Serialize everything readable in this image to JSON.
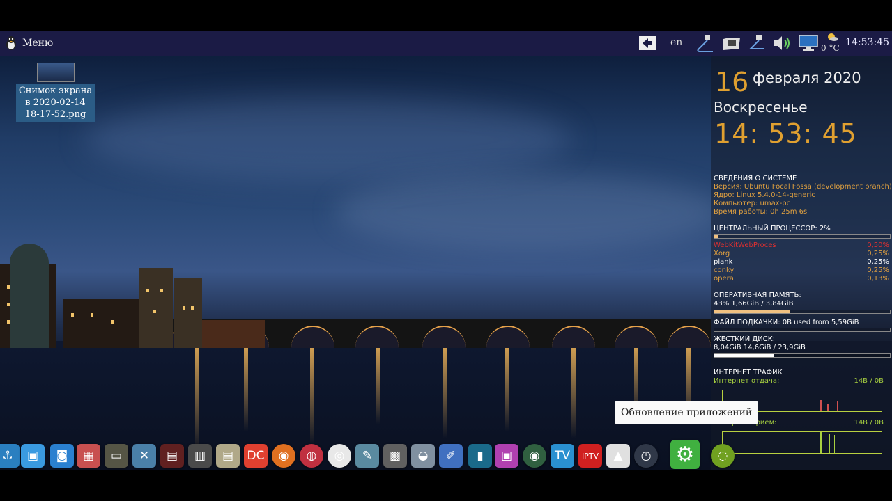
{
  "topbar": {
    "menu_label": "Меню",
    "lang": "en",
    "temperature": "0 °C",
    "clock": "14:53:45",
    "icons": [
      "back-arrow-icon",
      "pen-tablet-icon",
      "folder-mount-icon",
      "network-tool-icon",
      "volume-icon",
      "monitor-icon",
      "weather-icon"
    ]
  },
  "desktop": {
    "file_label": "Снимок экрана в 2020-02-14 18-17-52.png"
  },
  "conky": {
    "day": "16",
    "month_year": "февраля 2020",
    "weekday": "Воскресенье",
    "time": "14: 53: 45",
    "sys_head": "СВЕДЕНИЯ О СИСТЕМЕ",
    "version": "Версия: Ubuntu Focal Fossa (development branch)",
    "kernel": "Ядро: Linux 5.4.0-14-generic",
    "computer": "Компьютер: umax-pc",
    "uptime": "Время работы: 0h 25m 6s",
    "cpu_head": "ЦЕНТРАЛЬНЫЙ ПРОЦЕССОР: 2%",
    "cpu_percent": 2,
    "processes": [
      {
        "name": "WebKitWebProces",
        "value": "0,50%",
        "color": "#e03030"
      },
      {
        "name": "Xorg",
        "value": "0,25%",
        "color": "#e0a040"
      },
      {
        "name": "plank",
        "value": "0,25%",
        "color": "#ffffff"
      },
      {
        "name": "conky",
        "value": "0,25%",
        "color": "#e0a040"
      },
      {
        "name": "opera",
        "value": "0,13%",
        "color": "#e0a040"
      }
    ],
    "ram_head": "ОПЕРАТИВНАЯ ПАМЯТЬ:",
    "ram_value": "43% 1,66GiB / 3,84GiB",
    "ram_percent": 43,
    "swap_head": "ФАЙЛ ПОДКАЧКИ: 0B   used from 5,59GiB",
    "swap_percent": 0,
    "disk_head": "ЖЕСТКИЙ ДИСК:",
    "disk_value": "8,04GiB 14,6GiB / 23,9GiB",
    "disk_percent": 34,
    "net_head": "ИНТЕРНЕТ ТРАФИК",
    "up_label": "Интернет отдача:",
    "up_value": "14B    /  0B",
    "down_label": "Интернет прием:",
    "down_value": "14B    /  0B"
  },
  "tooltip": "Обновление приложений",
  "dock": [
    {
      "name": "anchor-icon",
      "glyph": "⚓",
      "color": "#2a7fc0"
    },
    {
      "name": "store-bag-icon",
      "glyph": "▣",
      "color": "#3a9ae0"
    },
    {
      "name": "software-center-icon",
      "glyph": "◙",
      "color": "#2a80d0"
    },
    {
      "name": "package-icon",
      "glyph": "▦",
      "color": "#c85050"
    },
    {
      "name": "terminal-icon",
      "glyph": "▭",
      "color": "#555545"
    },
    {
      "name": "settings-tools-icon",
      "glyph": "✕",
      "color": "#4a80a8"
    },
    {
      "name": "media-screen-icon",
      "glyph": "▤",
      "color": "#602020"
    },
    {
      "name": "typewriter-icon",
      "glyph": "▥",
      "color": "#4a4a4a"
    },
    {
      "name": "scanner-icon",
      "glyph": "▤",
      "color": "#b0a888"
    },
    {
      "name": "dc-app-icon",
      "glyph": "DC",
      "color": "#e04030"
    },
    {
      "name": "thunderbird-icon",
      "glyph": "◉",
      "color": "#e07020"
    },
    {
      "name": "browser-globe-icon",
      "glyph": "◍",
      "color": "#c03040"
    },
    {
      "name": "chrome-icon",
      "glyph": "◎",
      "color": "#e8e8e8"
    },
    {
      "name": "tablet-pen-icon",
      "glyph": "✎",
      "color": "#5a8aa0"
    },
    {
      "name": "video-editor-icon",
      "glyph": "▩",
      "color": "#606060"
    },
    {
      "name": "drive-icon",
      "glyph": "◒",
      "color": "#8090a0"
    },
    {
      "name": "brush-icon",
      "glyph": "✐",
      "color": "#4070c0"
    },
    {
      "name": "panel-icon",
      "glyph": "▮",
      "color": "#1a6a8a"
    },
    {
      "name": "photo-icon",
      "glyph": "▣",
      "color": "#b040b0"
    },
    {
      "name": "globe-icon",
      "glyph": "◉",
      "color": "#306040"
    },
    {
      "name": "tv-icon",
      "glyph": "TV",
      "color": "#2a90d0"
    },
    {
      "name": "iptv-icon",
      "glyph": "IPTV",
      "color": "#d02020"
    },
    {
      "name": "linux-penguin-icon",
      "glyph": "▲",
      "color": "#e0e0e0"
    },
    {
      "name": "disk-usage-icon",
      "glyph": "◴",
      "color": "#303848"
    },
    {
      "name": "update-apps-icon",
      "glyph": "⚙",
      "color": "#40b040"
    },
    {
      "name": "ubuntu-icon",
      "glyph": "◌",
      "color": "#70a020"
    }
  ]
}
